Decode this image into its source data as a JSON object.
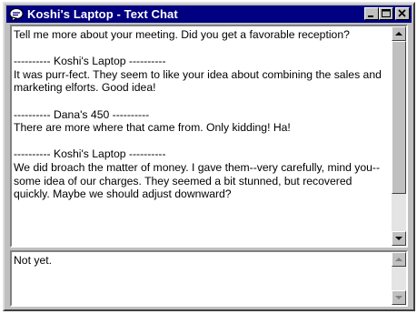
{
  "window": {
    "title": "Koshi's Laptop - Text Chat",
    "icon": "chat-bubble-icon",
    "title_bar_color": "#000080"
  },
  "controls": [
    "minimize-icon",
    "maximize-icon",
    "close-icon"
  ],
  "transcript": {
    "line_intro": "Tell me more about your meeting. Did you get a favorable reception?",
    "messages": [
      {
        "sender_header": "---------- Koshi's Laptop ----------",
        "text": "It was purr-fect. They seem to like your idea about combining the sales and marketing elforts. Good idea!"
      },
      {
        "sender_header": "---------- Dana's 450 ----------",
        "text": "There are more where that came from. Only kidding! Ha!"
      },
      {
        "sender_header": "---------- Koshi's Laptop ----------",
        "text": "We did broach the matter of money. I gave them--very carefully, mind you--some idea of our charges. They seemed a bit stunned, but recovered quickly. Maybe we should adjust downward?"
      }
    ]
  },
  "compose": {
    "value": "Not yet."
  }
}
